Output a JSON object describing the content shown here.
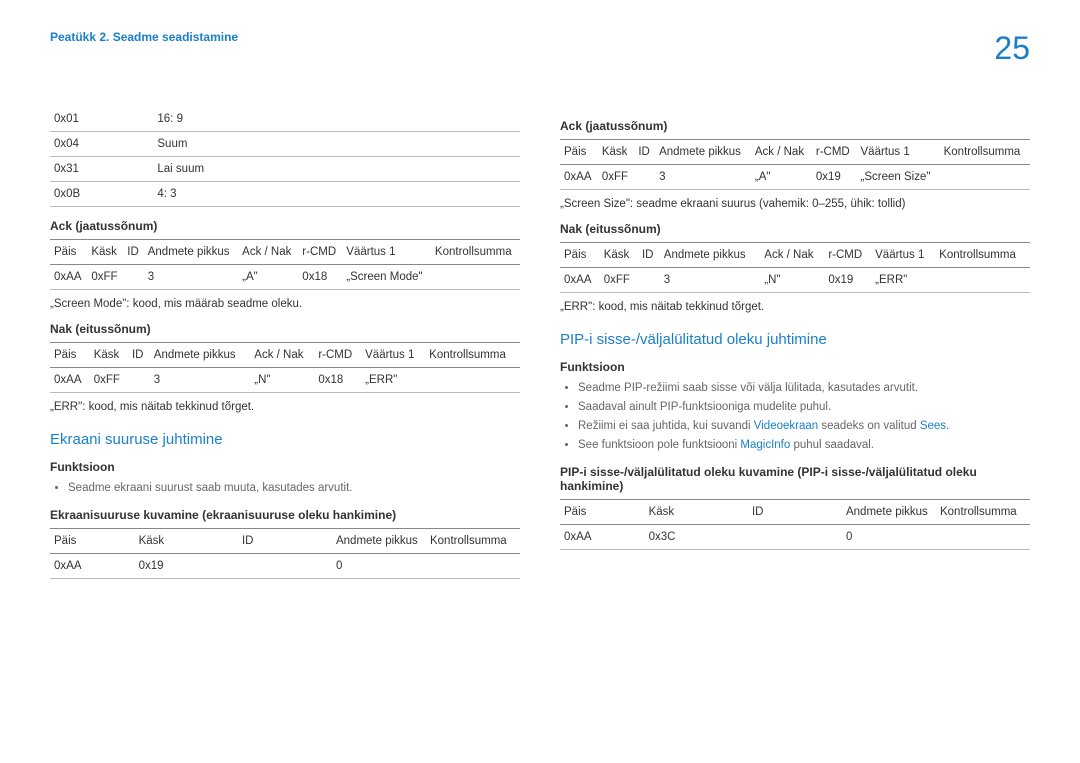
{
  "header": {
    "chapter": "Peatükk 2. Seadme seadistamine",
    "pageNumber": "25"
  },
  "left": {
    "codeTable": {
      "rows": [
        {
          "code": "0x01",
          "val": "16: 9"
        },
        {
          "code": "0x04",
          "val": "Suum"
        },
        {
          "code": "0x31",
          "val": "Lai suum"
        },
        {
          "code": "0x0B",
          "val": "4: 3"
        }
      ]
    },
    "ackTitle": "Ack (jaatussõnum)",
    "ackHeaders": [
      "Päis",
      "Käsk",
      "ID",
      "Andmete pikkus",
      "Ack / Nak",
      "r-CMD",
      "Väärtus 1",
      "Kontrollsumma"
    ],
    "ackRow": [
      "0xAA",
      "0xFF",
      "",
      "3",
      "„A\"",
      "0x18",
      "„Screen Mode\"",
      ""
    ],
    "ackNote": "„Screen Mode\": kood, mis määrab seadme oleku.",
    "nakTitle": "Nak (eitussõnum)",
    "nakHeaders": [
      "Päis",
      "Käsk",
      "ID",
      "Andmete pikkus",
      "Ack / Nak",
      "r-CMD",
      "Väärtus 1",
      "Kontrollsumma"
    ],
    "nakRow": [
      "0xAA",
      "0xFF",
      "",
      "3",
      "„N\"",
      "0x18",
      "„ERR\"",
      ""
    ],
    "nakNote": "„ERR\": kood, mis näitab tekkinud tõrget.",
    "section1": {
      "title": "Ekraani suuruse juhtimine",
      "funcLabel": "Funktsioon",
      "func1": "Seadme ekraani suurust saab muuta, kasutades arvutit.",
      "cmdTitle": "Ekraanisuuruse kuvamine (ekraanisuuruse oleku hankimine)",
      "cmdHeaders": [
        "Päis",
        "Käsk",
        "ID",
        "Andmete pikkus",
        "Kontrollsumma"
      ],
      "cmdRow": [
        "0xAA",
        "0x19",
        "",
        "0",
        ""
      ]
    }
  },
  "right": {
    "ackTitle": "Ack (jaatussõnum)",
    "ackHeaders": [
      "Päis",
      "Käsk",
      "ID",
      "Andmete pikkus",
      "Ack / Nak",
      "r-CMD",
      "Väärtus 1",
      "Kontrollsumma"
    ],
    "ackRow": [
      "0xAA",
      "0xFF",
      "",
      "3",
      "„A\"",
      "0x19",
      "„Screen Size\"",
      ""
    ],
    "ackNote": "„Screen Size\": seadme ekraani suurus (vahemik: 0–255, ühik: tollid)",
    "nakTitle": "Nak (eitussõnum)",
    "nakHeaders": [
      "Päis",
      "Käsk",
      "ID",
      "Andmete pikkus",
      "Ack / Nak",
      "r-CMD",
      "Väärtus 1",
      "Kontrollsumma"
    ],
    "nakRow": [
      "0xAA",
      "0xFF",
      "",
      "3",
      "„N\"",
      "0x19",
      "„ERR\"",
      ""
    ],
    "nakNote": "„ERR\": kood, mis näitab tekkinud tõrget.",
    "section2": {
      "title": "PIP-i sisse-/väljalülitatud oleku juhtimine",
      "funcLabel": "Funktsioon",
      "b1": "Seadme PIP-režiimi saab sisse või välja lülitada, kasutades arvutit.",
      "b2": "Saadaval ainult PIP-funktsiooniga mudelite puhul.",
      "b3a": "Režiimi ei saa juhtida, kui suvandi ",
      "b3hl": "Videoekraan",
      "b3b": " seadeks on valitud ",
      "b3hl2": "Sees",
      "b3c": ".",
      "b4a": "See funktsioon pole funktsiooni ",
      "b4hl": "MagicInfo",
      "b4b": " puhul saadaval.",
      "cmdTitle": "PIP-i sisse-/väljalülitatud oleku kuvamine (PIP-i sisse-/väljalülitatud oleku hankimine)",
      "cmdHeaders": [
        "Päis",
        "Käsk",
        "ID",
        "Andmete pikkus",
        "Kontrollsumma"
      ],
      "cmdRow": [
        "0xAA",
        "0x3C",
        "",
        "0",
        ""
      ]
    }
  }
}
